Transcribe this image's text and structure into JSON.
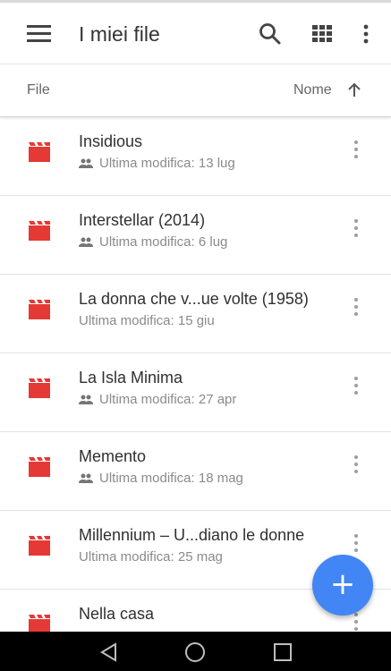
{
  "app": {
    "title": "I miei file"
  },
  "header": {
    "menu_icon": "hamburger-menu-icon",
    "search_icon": "search-icon",
    "grid_icon": "grid-view-icon",
    "more_icon": "more-vertical-icon"
  },
  "sortbar": {
    "left_label": "File",
    "sort_label": "Nome",
    "sort_direction_icon": "arrow-up-icon"
  },
  "files": [
    {
      "name": "Insidious",
      "shared": true,
      "modified": "Ultima modifica: 13 lug"
    },
    {
      "name": "Interstellar (2014)",
      "shared": true,
      "modified": "Ultima modifica: 6 lug"
    },
    {
      "name": "La donna che v...ue volte (1958)",
      "shared": false,
      "modified": "Ultima modifica: 15 giu"
    },
    {
      "name": "La Isla Minima",
      "shared": true,
      "modified": "Ultima modifica: 27 apr"
    },
    {
      "name": "Memento",
      "shared": true,
      "modified": "Ultima modifica: 18 mag"
    },
    {
      "name": "Millennium – U...diano le donne",
      "shared": false,
      "modified": "Ultima modifica: 25 mag"
    },
    {
      "name": "Nella casa",
      "shared": false,
      "modified": ""
    }
  ],
  "fab": {
    "label": "+",
    "icon": "add-icon"
  },
  "colors": {
    "file_icon": "#e53935",
    "fab": "#4285f4"
  }
}
